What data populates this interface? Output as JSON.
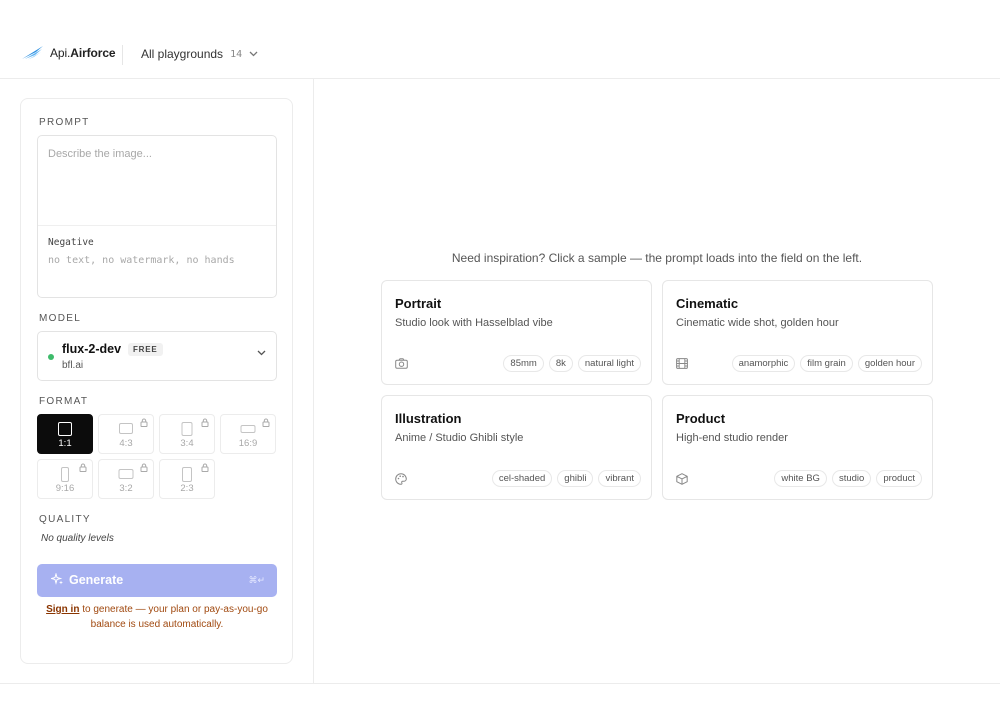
{
  "header": {
    "logo_prefix": "Api.",
    "logo_name": "Airforce",
    "playgrounds_label": "All playgrounds",
    "playgrounds_count": "14"
  },
  "panel": {
    "prompt": {
      "label": "PROMPT",
      "placeholder": "Describe the image...",
      "negative_label": "Negative",
      "negative_placeholder": "no text, no watermark, no hands"
    },
    "model": {
      "label": "MODEL",
      "name": "flux-2-dev",
      "badge": "FREE",
      "provider": "bfl.ai",
      "status_color": "#3dbb6a"
    },
    "format": {
      "label": "FORMAT",
      "options": [
        {
          "ratio": "1:1",
          "selected": true,
          "locked": false
        },
        {
          "ratio": "4:3",
          "selected": false,
          "locked": true
        },
        {
          "ratio": "3:4",
          "selected": false,
          "locked": true
        },
        {
          "ratio": "16:9",
          "selected": false,
          "locked": true
        },
        {
          "ratio": "9:16",
          "selected": false,
          "locked": true
        },
        {
          "ratio": "3:2",
          "selected": false,
          "locked": true
        },
        {
          "ratio": "2:3",
          "selected": false,
          "locked": true
        }
      ]
    },
    "quality": {
      "label": "QUALITY",
      "empty_text": "No quality levels"
    },
    "generate": {
      "label": "Generate",
      "shortcut": "⌘↵",
      "color": "#a7b1f1"
    },
    "signin": {
      "link_text": "Sign in",
      "rest_text": " to generate — your plan or pay-as-you-go balance is used automatically."
    }
  },
  "inspiration": {
    "text": "Need inspiration? Click a sample — the prompt loads into the field on the left.",
    "cards": [
      {
        "title": "Portrait",
        "subtitle": "Studio look with Hasselblad vibe",
        "icon": "camera-icon",
        "tags": [
          "85mm",
          "8k",
          "natural light"
        ]
      },
      {
        "title": "Cinematic",
        "subtitle": "Cinematic wide shot, golden hour",
        "icon": "film-icon",
        "tags": [
          "anamorphic",
          "film grain",
          "golden hour"
        ]
      },
      {
        "title": "Illustration",
        "subtitle": "Anime / Studio Ghibli style",
        "icon": "palette-icon",
        "tags": [
          "cel-shaded",
          "ghibli",
          "vibrant"
        ]
      },
      {
        "title": "Product",
        "subtitle": "High-end studio render",
        "icon": "box-icon",
        "tags": [
          "white BG",
          "studio",
          "product"
        ]
      }
    ]
  }
}
